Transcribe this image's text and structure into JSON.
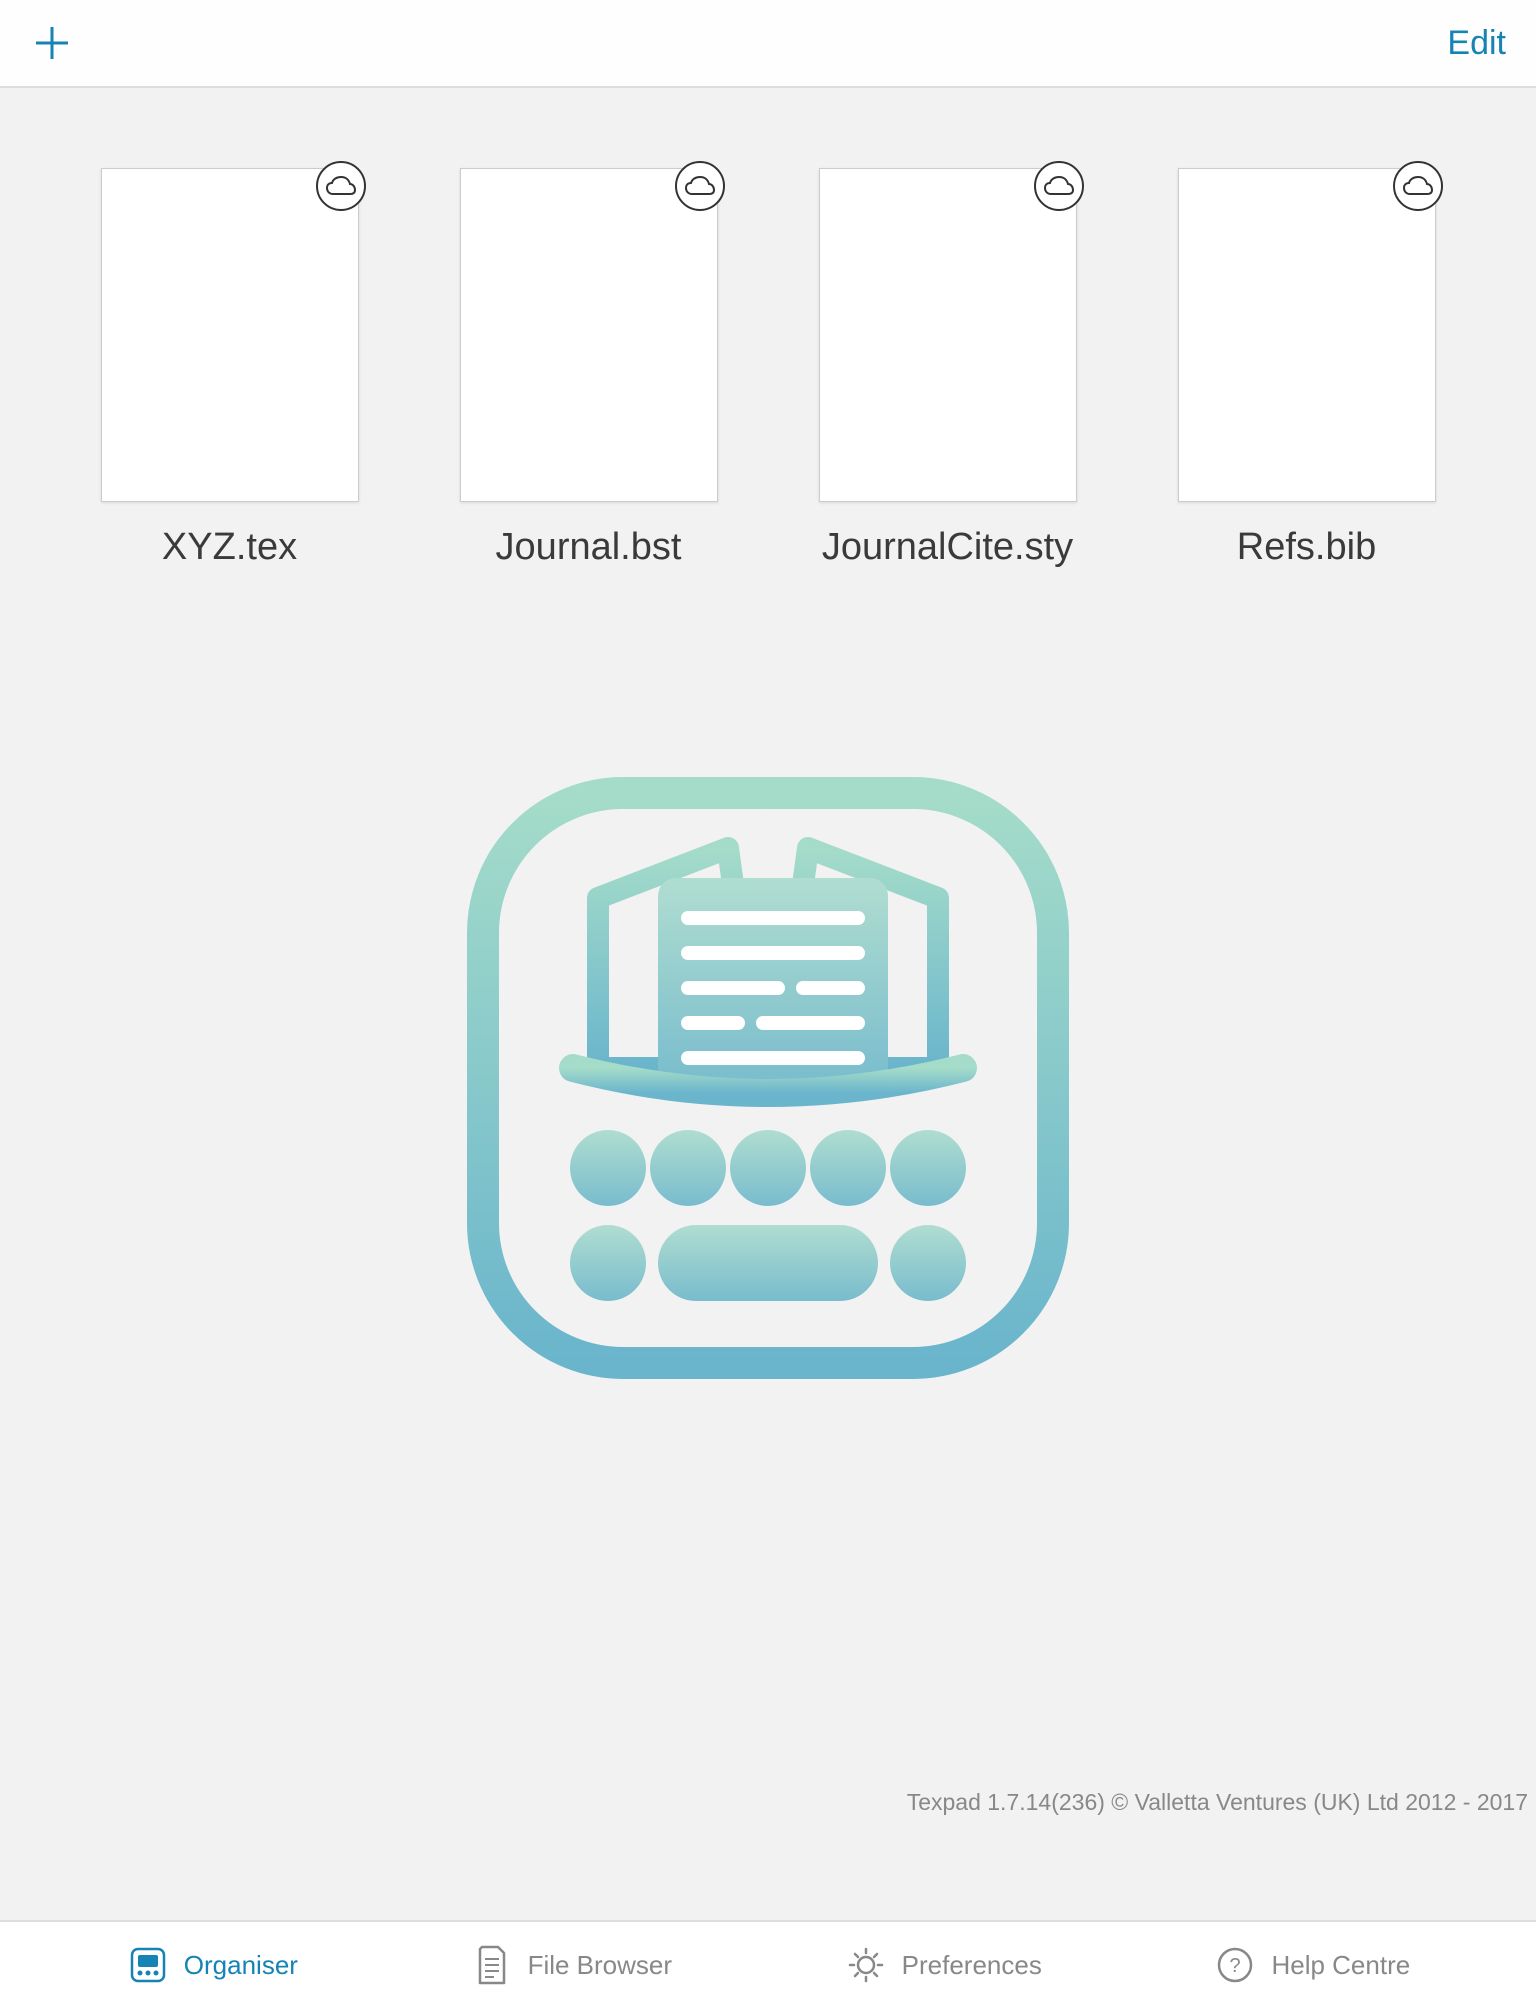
{
  "topbar": {
    "edit_label": "Edit"
  },
  "files": [
    {
      "name": "XYZ.tex",
      "cloud": true
    },
    {
      "name": "Journal.bst",
      "cloud": true
    },
    {
      "name": "JournalCite.sty",
      "cloud": true
    },
    {
      "name": "Refs.bib",
      "cloud": true
    }
  ],
  "footer": {
    "text": "Texpad 1.7.14(236) © Valletta Ventures (UK) Ltd 2012 - 2017"
  },
  "tabs": [
    {
      "label": "Organiser",
      "active": true
    },
    {
      "label": "File Browser",
      "active": false
    },
    {
      "label": "Preferences",
      "active": false
    },
    {
      "label": "Help Centre",
      "active": false
    }
  ],
  "colors": {
    "accent": "#1584b4",
    "background": "#f2f2f2",
    "logo_gradient_start": "#a0d9c8",
    "logo_gradient_end": "#68b3cb"
  }
}
